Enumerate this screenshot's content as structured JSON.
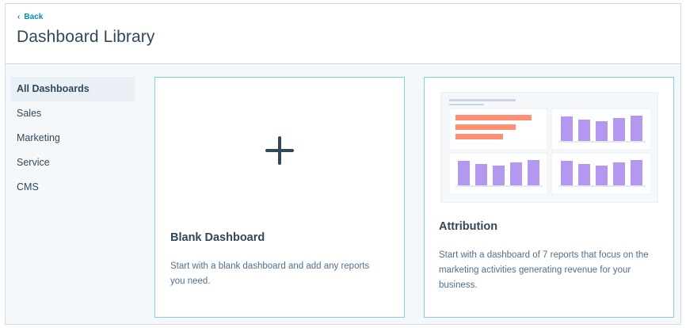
{
  "header": {
    "back_label": "Back",
    "title": "Dashboard Library"
  },
  "sidebar": {
    "items": [
      {
        "label": "All Dashboards",
        "active": true
      },
      {
        "label": "Sales",
        "active": false
      },
      {
        "label": "Marketing",
        "active": false
      },
      {
        "label": "Service",
        "active": false
      },
      {
        "label": "CMS",
        "active": false
      }
    ]
  },
  "cards": {
    "blank": {
      "icon": "plus-icon",
      "title": "Blank Dashboard",
      "description": "Start with a blank dashboard and add any reports you need."
    },
    "attribution": {
      "title": "Attribution",
      "description": "Start with a dashboard of 7 reports that focus on the marketing activities generating revenue for your business."
    }
  },
  "colors": {
    "accent_link": "#0091ae",
    "card_border": "#7fd1de",
    "bar_orange": "#ff8f73",
    "bar_purple": "#b497ef",
    "text": "#33475b"
  }
}
